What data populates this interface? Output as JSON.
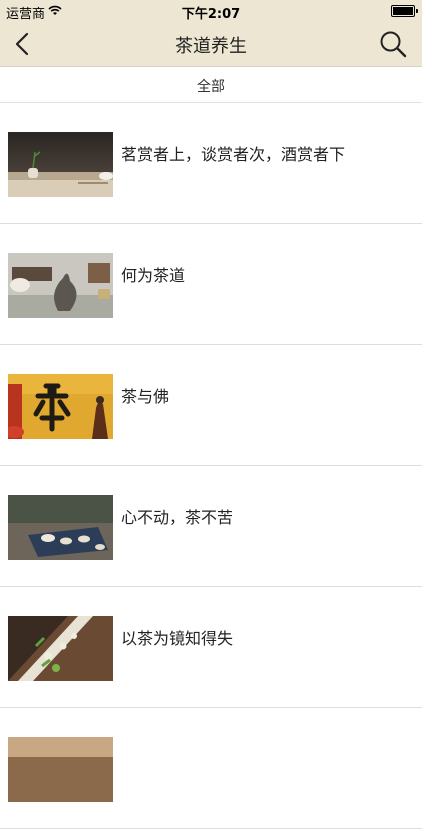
{
  "status": {
    "carrier": "运营商",
    "time": "下午2:07"
  },
  "nav": {
    "title": "茶道养生"
  },
  "filter": {
    "label": "全部"
  },
  "items": [
    {
      "title": "茗赏者上，谈赏者次，酒赏者下"
    },
    {
      "title": "何为茶道"
    },
    {
      "title": "茶与佛"
    },
    {
      "title": "心不动，茶不苦"
    },
    {
      "title": "以茶为镜知得失"
    },
    {
      "title": ""
    }
  ],
  "colors": {
    "header_bg": "#ece6d2",
    "divider": "#dedede"
  }
}
